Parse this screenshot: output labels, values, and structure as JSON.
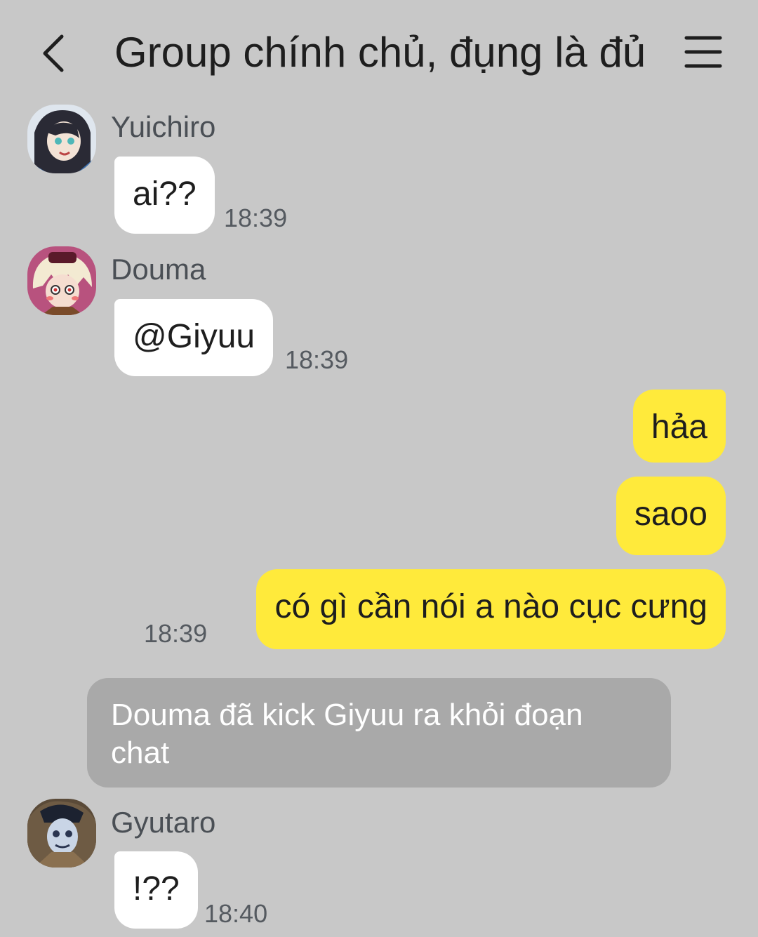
{
  "header": {
    "title": "Group chính chủ, đụng là đủ",
    "back_icon": "chevron-left-icon",
    "menu_icon": "hamburger-menu-icon"
  },
  "messages": [
    {
      "sender": "Yuichiro",
      "text": "ai??",
      "time": "18:39"
    },
    {
      "sender": "Douma",
      "text": "@Giyuu",
      "time": "18:39"
    },
    {
      "text": "hảa"
    },
    {
      "text": "saoo"
    },
    {
      "text": "có gì cần nói a nào cục cưng",
      "time": "18:39"
    },
    {
      "sender": "Gyutaro",
      "text": "!??",
      "time": "18:40"
    }
  ],
  "system_notice": "Douma đã kick Giyuu ra khỏi đoạn chat",
  "colors": {
    "background": "#c8c8c8",
    "incoming_bubble": "#ffffff",
    "outgoing_bubble": "#ffea3b",
    "system_notice_bg": "#a9a9a9"
  }
}
